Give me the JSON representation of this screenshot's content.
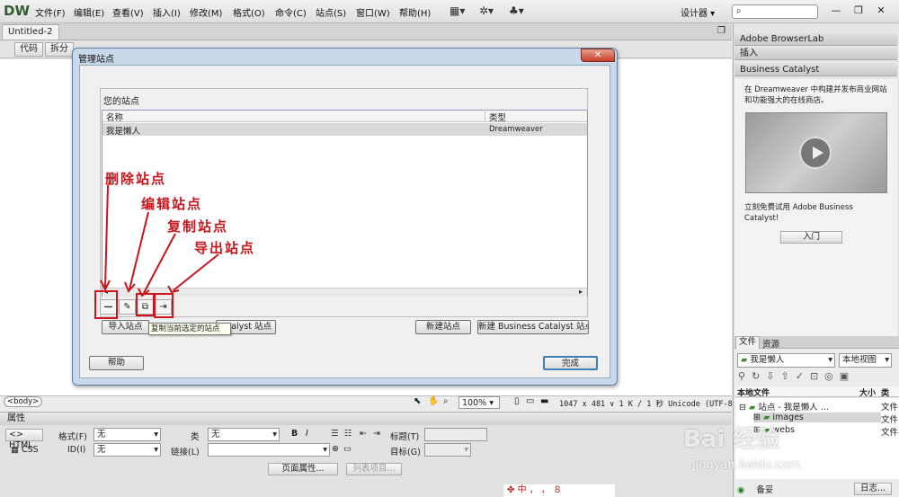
{
  "app": {
    "logo": "DW",
    "menus": [
      "文件(F)",
      "编辑(E)",
      "查看(V)",
      "插入(I)",
      "修改(M)",
      "格式(O)",
      "命令(C)",
      "站点(S)",
      "窗口(W)",
      "帮助(H)"
    ],
    "workspace": "设计器",
    "search_placeholder": "",
    "window_controls": [
      "—",
      "❐",
      "✕"
    ]
  },
  "document": {
    "tab": "Untitled-2",
    "tab_close": "×",
    "view_buttons": [
      "代码",
      "拆分"
    ],
    "status_tag": "<body>",
    "zoom": "100%",
    "status_info": "1047 x 481 ∨ 1 K / 1 秒  Unicode (UTF-8)"
  },
  "properties": {
    "header": "属性",
    "html_btn": "HTML",
    "css_btn": "CSS",
    "format_label": "格式(F)",
    "format_value": "无",
    "class_label": "类",
    "class_value": "无",
    "id_label": "ID(I)",
    "id_value": "无",
    "link_label": "链接(L)",
    "bold": "B",
    "italic": "I",
    "title_label": "标题(T)",
    "target_label": "目标(G)",
    "page_props_btn": "页面属性...",
    "list_item_btn": "列表项目..."
  },
  "right_panels": {
    "browserlab": "Adobe BrowserLab",
    "insert": "插入",
    "bc_title": "Business Catalyst",
    "bc_desc": "在 Dreamweaver 中构建并发布商业网站和功能强大的在线商店。",
    "bc_trial": "立刻免费试用 Adobe Business Catalyst!",
    "bc_btn": "入门",
    "files_tab": "文件",
    "assets_tab": "资源",
    "site_select": "我是懒人",
    "view_select": "本地视图",
    "col_local": "本地文件",
    "col_size": "大小",
    "col_type": "类",
    "tree": [
      {
        "label": "站点 - 我是懒人 ...",
        "type": "文件"
      },
      {
        "label": "images",
        "type": "文件"
      },
      {
        "label": "webs",
        "type": "文件"
      }
    ],
    "footer_label": "备妥",
    "log_btn": "日志..."
  },
  "dialog": {
    "title": "管理站点",
    "close": "✕",
    "group_label": "您的站点",
    "col_name": "名称",
    "col_type": "类型",
    "sites": [
      {
        "name": "我是懒人",
        "type": "Dreamweaver"
      }
    ],
    "tooltip": "复制当前选定的站点",
    "import_site": "导入站点",
    "import_bc": "atalyst 站点",
    "new_site": "新建站点",
    "new_bc": "新建 Business Catalyst 站点",
    "help": "帮助",
    "done": "完成"
  },
  "annotations": [
    "删除站点",
    "编辑站点",
    "复制站点",
    "导出站点"
  ],
  "ime": "中 ， ，   ８",
  "watermark": {
    "brand": "Bai 经验",
    "url": "jingyan.baidu.com"
  },
  "colors": {
    "annotation": "#c8161d",
    "dialog_frame": "#c9d8ea",
    "close_btn": "#c8412c"
  }
}
